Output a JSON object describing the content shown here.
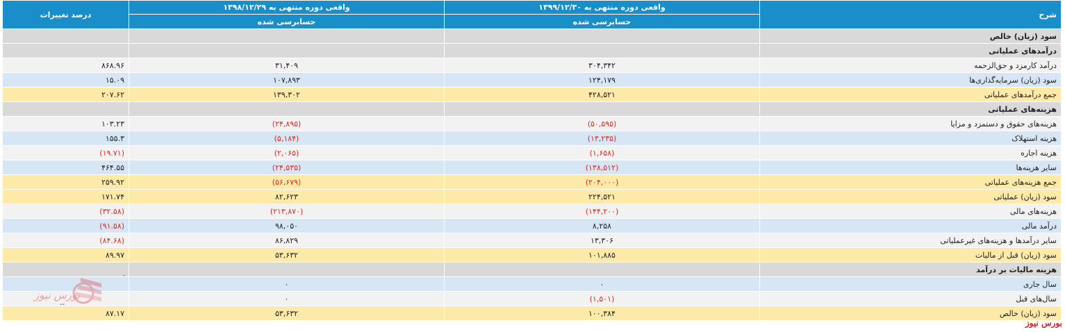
{
  "header": {
    "desc": "شرح",
    "current": "واقعی دوره منتهی به ۱۳۹۹/۱۲/۳۰",
    "previous": "واقعی دوره منتهی به ۱۳۹۸/۱۲/۲۹",
    "pct": "درصد تغییرات",
    "current_sub": "حسابرسی شده",
    "previous_sub": "حسابرسی شده"
  },
  "rows": [
    {
      "desc": "سود (زیان) خالص",
      "cur": "",
      "prev": "",
      "pct": "",
      "style": "gray"
    },
    {
      "desc": "درآمدهای عملیاتی",
      "cur": "",
      "prev": "",
      "pct": "",
      "style": "gray"
    },
    {
      "desc": "درآمد کارمزد و حق‌الزحمه",
      "cur": "۳۰۴,۳۴۲",
      "prev": "۳۱,۴۰۹",
      "pct": "۸۶۸.۹۶",
      "style": "white"
    },
    {
      "desc": "سود (زیان) سرمایه‌گذاری‌ها",
      "cur": "۱۲۴,۱۷۹",
      "prev": "۱۰۷,۸۹۳",
      "pct": "۱۵.۰۹",
      "style": "blue"
    },
    {
      "desc": "جمع درآمدهای عملیاتی",
      "cur": "۴۲۸,۵۲۱",
      "prev": "۱۳۹,۳۰۲",
      "pct": "۲۰۷.۶۲",
      "style": "yellow"
    },
    {
      "desc": "هزینه‌های عملیاتی",
      "cur": "",
      "prev": "",
      "pct": "",
      "style": "gray"
    },
    {
      "desc": "هزینه‌های حقوق و دستمزد و مزایا",
      "cur": "(۵۰,۵۹۵)",
      "prev": "(۲۴,۸۹۵)",
      "pct": "۱۰۳.۲۳",
      "style": "white"
    },
    {
      "desc": "هزینه استهلاک",
      "cur": "(۱۳,۲۳۵)",
      "prev": "(۵,۱۸۴)",
      "pct": "۱۵۵.۳",
      "style": "blue"
    },
    {
      "desc": "هزینه اجاره",
      "cur": "(۱,۶۵۸)",
      "prev": "(۲,۰۶۵)",
      "pct": "(۱۹.۷۱)",
      "style": "white"
    },
    {
      "desc": "سایر هزینه‌ها",
      "cur": "(۱۳۸,۵۱۲)",
      "prev": "(۲۴,۵۳۵)",
      "pct": "۴۶۴.۵۵",
      "style": "blue"
    },
    {
      "desc": "جمع هزینه‌های عملیاتی",
      "cur": "(۲۰۴,۰۰۰)",
      "prev": "(۵۶,۶۷۹)",
      "pct": "۲۵۹.۹۲",
      "style": "yellow"
    },
    {
      "desc": "سود (زیان) عملیاتی",
      "cur": "۲۲۴,۵۲۱",
      "prev": "۸۲,۶۲۳",
      "pct": "۱۷۱.۷۴",
      "style": "yellow"
    },
    {
      "desc": "هزینه‌های مالی",
      "cur": "(۱۴۴,۲۰۰)",
      "prev": "(۲۱۳,۸۷۰)",
      "pct": "(۳۲.۵۸)",
      "style": "white"
    },
    {
      "desc": "درآمد مالی",
      "cur": "۸,۲۵۸",
      "prev": "۹۸,۰۵۰",
      "pct": "(۹۱.۵۸)",
      "style": "blue"
    },
    {
      "desc": "سایر درآمدها و هزینه‌های غیرعملیاتی",
      "cur": "۱۳,۳۰۶",
      "prev": "۸۶,۸۲۹",
      "pct": "(۸۴.۶۸)",
      "style": "white"
    },
    {
      "desc": "سود (زیان) قبل از مالیات",
      "cur": "۱۰۱,۸۸۵",
      "prev": "۵۳,۶۳۲",
      "pct": "۸۹.۹۷",
      "style": "yellow"
    },
    {
      "desc": "هزینه مالیات بر درآمد",
      "cur": "",
      "prev": "",
      "pct": "",
      "style": "gray"
    },
    {
      "desc": "سال جاری",
      "cur": "۰",
      "prev": "۰",
      "pct": "",
      "style": "blue"
    },
    {
      "desc": "سال‌های قبل",
      "cur": "(۱,۵۰۱)",
      "prev": "۰",
      "pct": "",
      "style": "white"
    },
    {
      "desc": "سود (زیان) خالص",
      "cur": "۱۰۰,۳۸۴",
      "prev": "۵۳,۶۳۲",
      "pct": "۸۷.۱۷",
      "style": "yellow"
    }
  ],
  "extras": {
    "stray_dot": "۰",
    "stray_dash": "--",
    "footer_logo": "بورس نیوز",
    "watermark_text": "بورس نیوز"
  },
  "colors": {
    "header_bg": "#1a8ec9",
    "negative": "#e0281b",
    "row_gray": "#d9d9d9",
    "row_blue": "#d7e6f5",
    "row_yellow": "#fde9a8",
    "row_white": "#f2f2f2"
  }
}
